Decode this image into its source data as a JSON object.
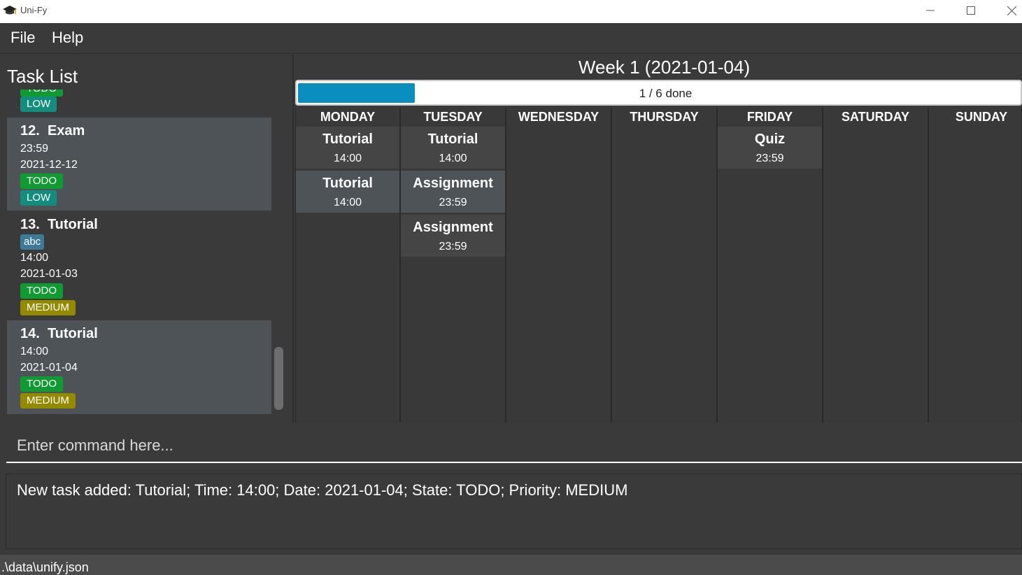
{
  "window": {
    "title": "Uni-Fy",
    "icon": "graduation-cap-icon"
  },
  "menu": {
    "file": "File",
    "help": "Help"
  },
  "task_list": {
    "title": "Task List",
    "partial_top": {
      "priority": "LOW"
    },
    "tasks": [
      {
        "index": "12.",
        "name": "Exam",
        "time": "23:59",
        "date": "2021-12-12",
        "state": "TODO",
        "priority": "LOW"
      },
      {
        "index": "13.",
        "name": "Tutorial",
        "tag": "abc",
        "time": "14:00",
        "date": "2021-01-03",
        "state": "TODO",
        "priority": "MEDIUM"
      },
      {
        "index": "14.",
        "name": "Tutorial",
        "time": "14:00",
        "date": "2021-01-04",
        "state": "TODO",
        "priority": "MEDIUM"
      }
    ]
  },
  "calendar": {
    "week_title": "Week 1 (2021-01-04)",
    "progress_label": "1 / 6 done",
    "progress_fraction": 0.1667,
    "days": [
      {
        "name": "MONDAY",
        "events": [
          {
            "name": "Tutorial",
            "time": "14:00"
          },
          {
            "name": "Tutorial",
            "time": "14:00"
          }
        ]
      },
      {
        "name": "TUESDAY",
        "events": [
          {
            "name": "Tutorial",
            "time": "14:00"
          },
          {
            "name": "Assignment",
            "time": "23:59"
          },
          {
            "name": "Assignment",
            "time": "23:59"
          }
        ]
      },
      {
        "name": "WEDNESDAY",
        "events": []
      },
      {
        "name": "THURSDAY",
        "events": []
      },
      {
        "name": "FRIDAY",
        "events": [
          {
            "name": "Quiz",
            "time": "23:59"
          }
        ]
      },
      {
        "name": "SATURDAY",
        "events": []
      },
      {
        "name": "SUNDAY",
        "events": []
      }
    ]
  },
  "command": {
    "placeholder": "Enter command here..."
  },
  "result": {
    "text": "New task added: Tutorial; Time: 14:00; Date: 2021-01-04; State: TODO; Priority: MEDIUM"
  },
  "status": {
    "path": ".\\data\\unify.json"
  },
  "colors": {
    "todo": "#109a32",
    "low": "#138e7e",
    "medium": "#938a00",
    "tag": "#3d7a98",
    "progress": "#0a8ebf"
  }
}
